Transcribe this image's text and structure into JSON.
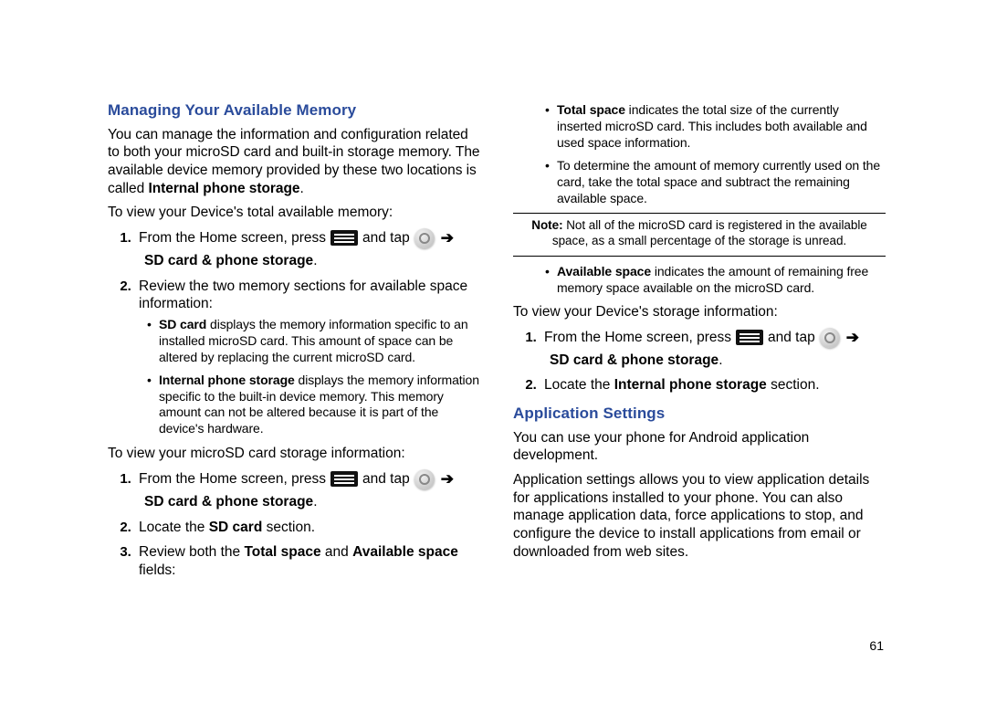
{
  "page_number": "61",
  "left": {
    "h_memory": "Managing Your Available Memory",
    "p_intro_1": "You can manage the information and configuration related to both your microSD card and built-in storage memory. The available device memory provided by these two locations is called ",
    "p_intro_bold": "Internal phone storage",
    "p_view_total": "To view your Device's total available memory:",
    "step1_pre": "From the Home screen, press",
    "step1_mid": "and tap",
    "arrow": "➔",
    "sd_phone_storage": "SD card & phone storage",
    "step2": "Review the two memory sections for available space information:",
    "bullet_sd_bold": "SD card",
    "bullet_sd_text": " displays the memory information specific to an installed microSD card. This amount of space can be altered by replacing the current microSD card.",
    "bullet_ips_bold": "Internal phone storage",
    "bullet_ips_text": " displays the memory information specific to the built-in device memory. This memory amount can not be altered because it is part of the device's hardware.",
    "p_view_sd": "To view your microSD card storage information:",
    "step2b": "Locate the ",
    "step2b_bold": "SD card",
    "step2b_after": " section.",
    "step3_pre": "Review both the ",
    "step3_bold1": "Total space",
    "step3_mid": " and ",
    "step3_bold2": "Available space",
    "step3_after": " fields:"
  },
  "right": {
    "bullet_total_bold": "Total space",
    "bullet_total_text": " indicates the total size of the currently inserted microSD card. This includes both available and used space information.",
    "bullet_determine": "To determine the amount of memory currently used on the card, take the total space and subtract the remaining available space.",
    "note_bold": "Note:",
    "note_text": " Not all of the microSD card is registered in the available space, as a small percentage of the storage is unread.",
    "bullet_avail_bold": "Available space",
    "bullet_avail_text": " indicates the amount of remaining free memory space available on the microSD card.",
    "p_view_storage": "To view your Device's storage information:",
    "step1_pre": "From the Home screen, press",
    "step1_mid": "and tap",
    "arrow": "➔",
    "sd_phone_storage": "SD card & phone storage",
    "step2_pre": "Locate the ",
    "step2_bold": "Internal phone storage",
    "step2_after": " section.",
    "h_app": "Application Settings",
    "p_app1": "You can use your phone for Android application development.",
    "p_app2": "Application settings allows you to view application details for applications installed to your phone. You can also manage application data, force applications to stop, and configure the device to install applications from email or downloaded from web sites."
  }
}
